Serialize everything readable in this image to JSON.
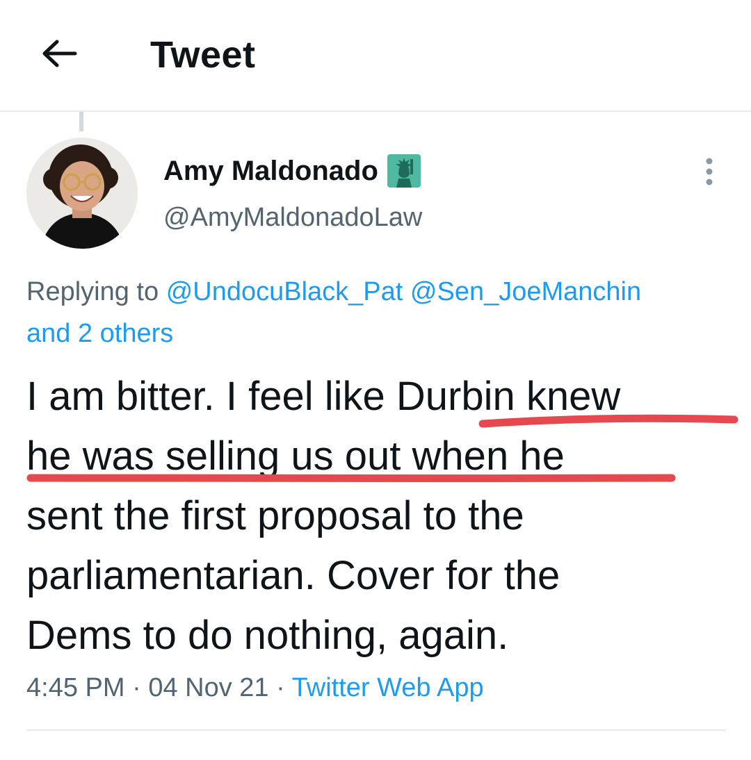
{
  "header": {
    "back_icon": "arrow-left-icon",
    "title": "Tweet"
  },
  "author": {
    "display_name": "Amy Maldonado",
    "badge_icon": "statue-of-liberty-icon",
    "handle": "@AmyMaldonadoLaw",
    "avatar_icon": "profile-photo"
  },
  "more_icon": "more-vertical-icon",
  "reply_context": {
    "prefix": "Replying to",
    "mention_1": "@UndocuBlack_Pat",
    "mention_2": "@Sen_JoeManchin",
    "others": "and 2 others"
  },
  "tweet": {
    "lines": [
      "I am bitter. I feel like Durbin knew",
      "he was selling us out when he",
      "sent the first proposal to the",
      "parliamentarian.  Cover for the",
      "Dems to do nothing, again."
    ],
    "highlight_color": "#e5484d"
  },
  "meta": {
    "time": "4:45 PM",
    "separator_1": " · ",
    "date": "04 Nov 21",
    "separator_2": " · ",
    "source": "Twitter Web App"
  },
  "colors": {
    "link": "#1d9bf0",
    "secondary_text": "#536471",
    "primary_text": "#0f1419",
    "divider": "#e7e9ea"
  }
}
